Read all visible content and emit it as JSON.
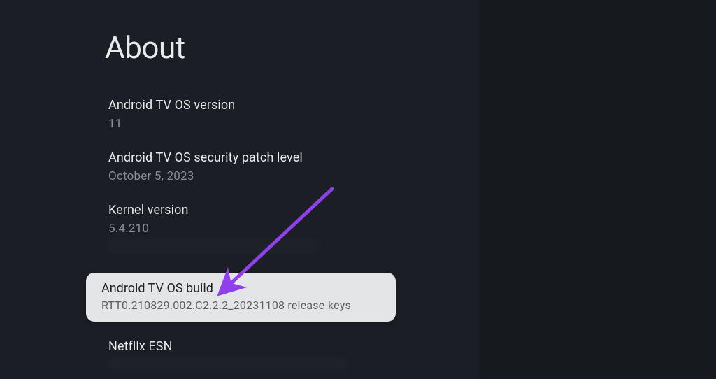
{
  "page": {
    "title": "About"
  },
  "cutoff_row": {
    "text": "…"
  },
  "settings": [
    {
      "label": "Android TV OS version",
      "value": "11"
    },
    {
      "label": "Android TV OS security patch level",
      "value": "October 5, 2023"
    },
    {
      "label": "Kernel version",
      "value": "5.4.210"
    }
  ],
  "focused": {
    "label": "Android TV OS build",
    "value": "RTT0.210829.002.C2.2.2_20231108 release-keys"
  },
  "next_row": {
    "label": "Netflix ESN"
  },
  "annotation": {
    "arrow_color": "#8f3fec"
  }
}
